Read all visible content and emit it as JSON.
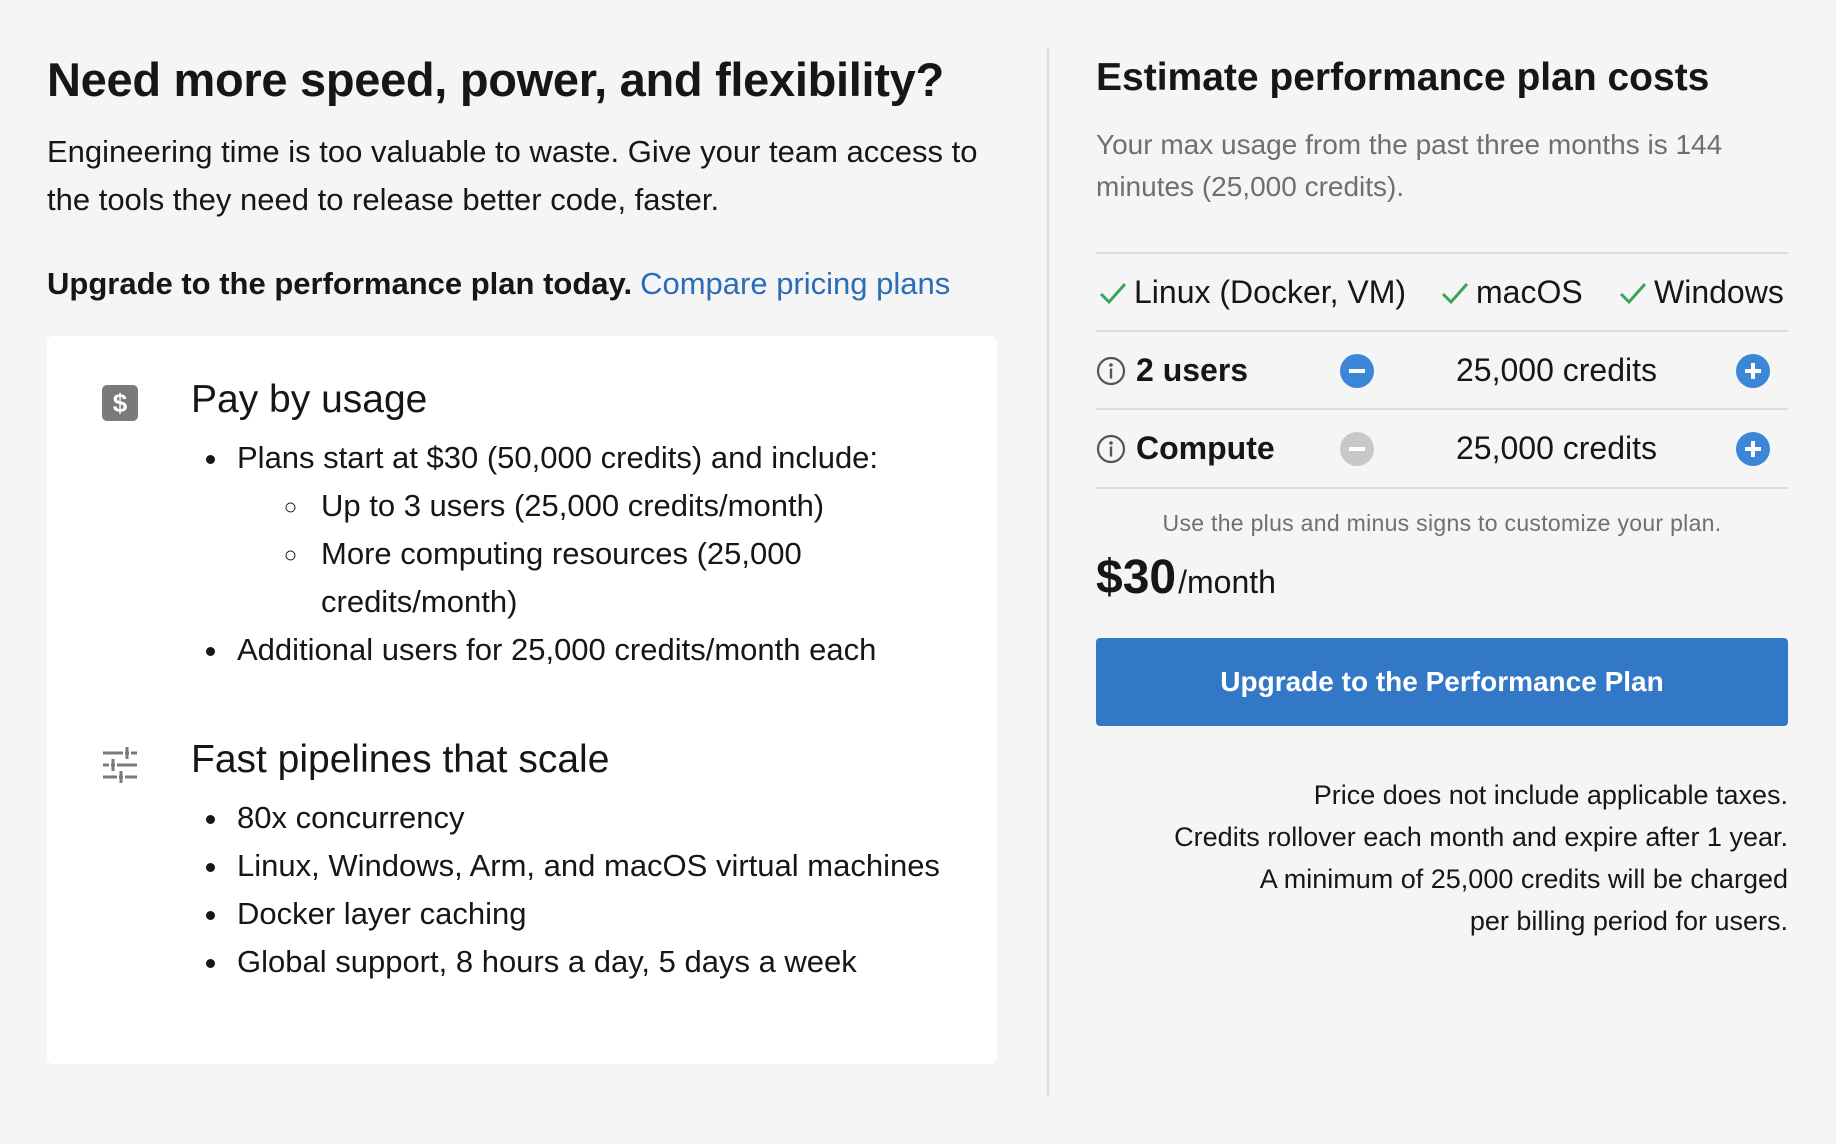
{
  "left": {
    "headline": "Need more speed, power, and flexibility?",
    "intro": "Engineering time is too valuable to waste. Give your team access to the tools they need to release better code, faster.",
    "cta_bold": "Upgrade to the performance plan today.",
    "cta_link": "Compare pricing plans",
    "sections": [
      {
        "icon": "dollar-icon",
        "title": "Pay by usage",
        "item1": "Plans start at $30 (50,000 credits) and include:",
        "sub1": "Up to 3 users (25,000 credits/month)",
        "sub2": "More computing resources (25,000 credits/month)",
        "item2": "Additional users for 25,000 credits/month each"
      },
      {
        "icon": "sliders-icon",
        "title": "Fast pipelines that scale",
        "items": [
          "80x concurrency",
          "Linux, Windows, Arm, and macOS virtual machines",
          "Docker layer caching",
          "Global support, 8 hours a day, 5 days a week"
        ]
      }
    ]
  },
  "right": {
    "title": "Estimate performance plan costs",
    "subtitle": "Your max usage from the past three months is 144 minutes (25,000 credits).",
    "os": [
      "Linux (Docker, VM)",
      "macOS",
      "Windows"
    ],
    "users": {
      "label": "2 users",
      "value": "25,000 credits"
    },
    "compute": {
      "label": "Compute",
      "value": "25,000 credits"
    },
    "hint": "Use the plus and minus signs to customize your plan.",
    "price_amount": "$30",
    "price_period": "/month",
    "button": "Upgrade to the Performance Plan",
    "notes": [
      "Price does not include applicable taxes.",
      "Credits rollover each month and expire after 1 year.",
      "A minimum of 25,000 credits will be charged per billing period for users."
    ]
  },
  "colors": {
    "link": "#2b6cb8",
    "button": "#3278c6",
    "stepper_active": "#3b86d6",
    "stepper_disabled": "#c8c8c8",
    "check": "#3aa35a"
  }
}
